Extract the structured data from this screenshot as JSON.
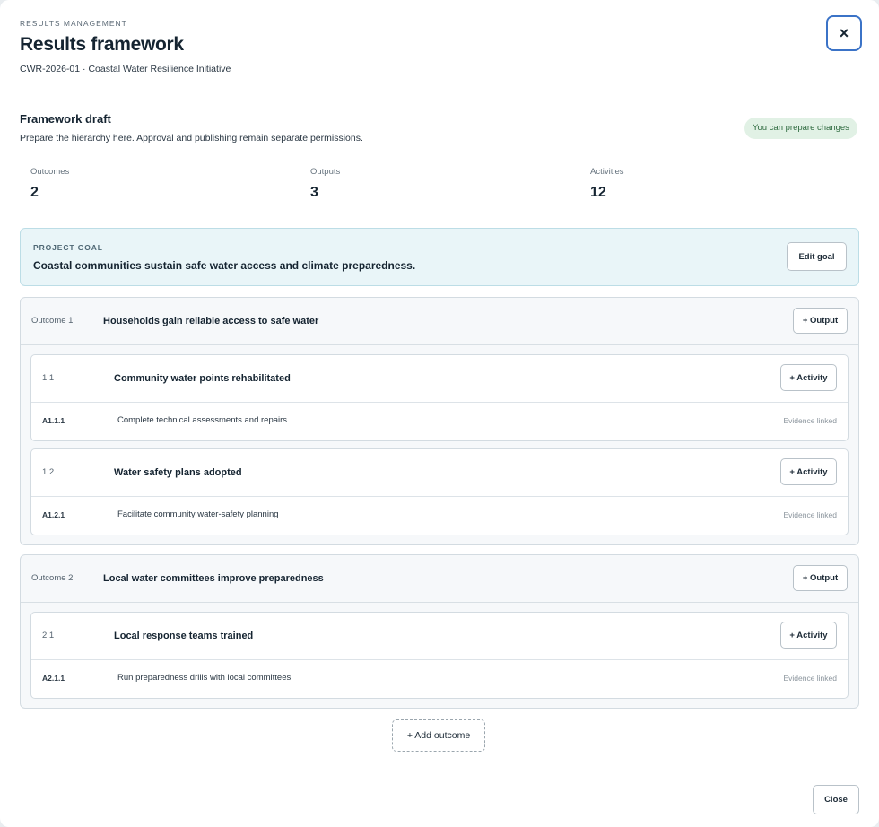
{
  "header": {
    "eyebrow": "RESULTS MANAGEMENT",
    "title": "Results framework",
    "subtitle": "CWR-2026-01 · Coastal Water Resilience Initiative",
    "close_icon": "×"
  },
  "draft": {
    "title": "Framework draft",
    "description": "Prepare the hierarchy here. Approval and publishing remain separate permissions.",
    "permission_badge": "You can prepare changes"
  },
  "stats": [
    {
      "label": "Outcomes",
      "value": "2"
    },
    {
      "label": "Outputs",
      "value": "3"
    },
    {
      "label": "Activities",
      "value": "12"
    }
  ],
  "goal": {
    "eyebrow": "PROJECT GOAL",
    "text": "Coastal communities sustain safe water access and climate preparedness.",
    "edit_label": "Edit goal"
  },
  "outcomes": [
    {
      "number": "Outcome 1",
      "title": "Households gain reliable access to safe water",
      "add_output_label": "+ Output",
      "outputs": [
        {
          "number": "1.1",
          "title": "Community water points rehabilitated",
          "add_activity_label": "+ Activity",
          "activity": {
            "code": "A1.1.1",
            "text": "Complete technical assessments and repairs",
            "status": "Evidence linked"
          }
        },
        {
          "number": "1.2",
          "title": "Water safety plans adopted",
          "add_activity_label": "+ Activity",
          "activity": {
            "code": "A1.2.1",
            "text": "Facilitate community water-safety planning",
            "status": "Evidence linked"
          }
        }
      ]
    },
    {
      "number": "Outcome 2",
      "title": "Local water committees improve preparedness",
      "add_output_label": "+ Output",
      "outputs": [
        {
          "number": "2.1",
          "title": "Local response teams trained",
          "add_activity_label": "+ Activity",
          "activity": {
            "code": "A2.1.1",
            "text": "Run preparedness drills with local committees",
            "status": "Evidence linked"
          }
        }
      ]
    }
  ],
  "footer": {
    "add_outcome_label": "+ Add outcome",
    "close_label": "Close"
  }
}
